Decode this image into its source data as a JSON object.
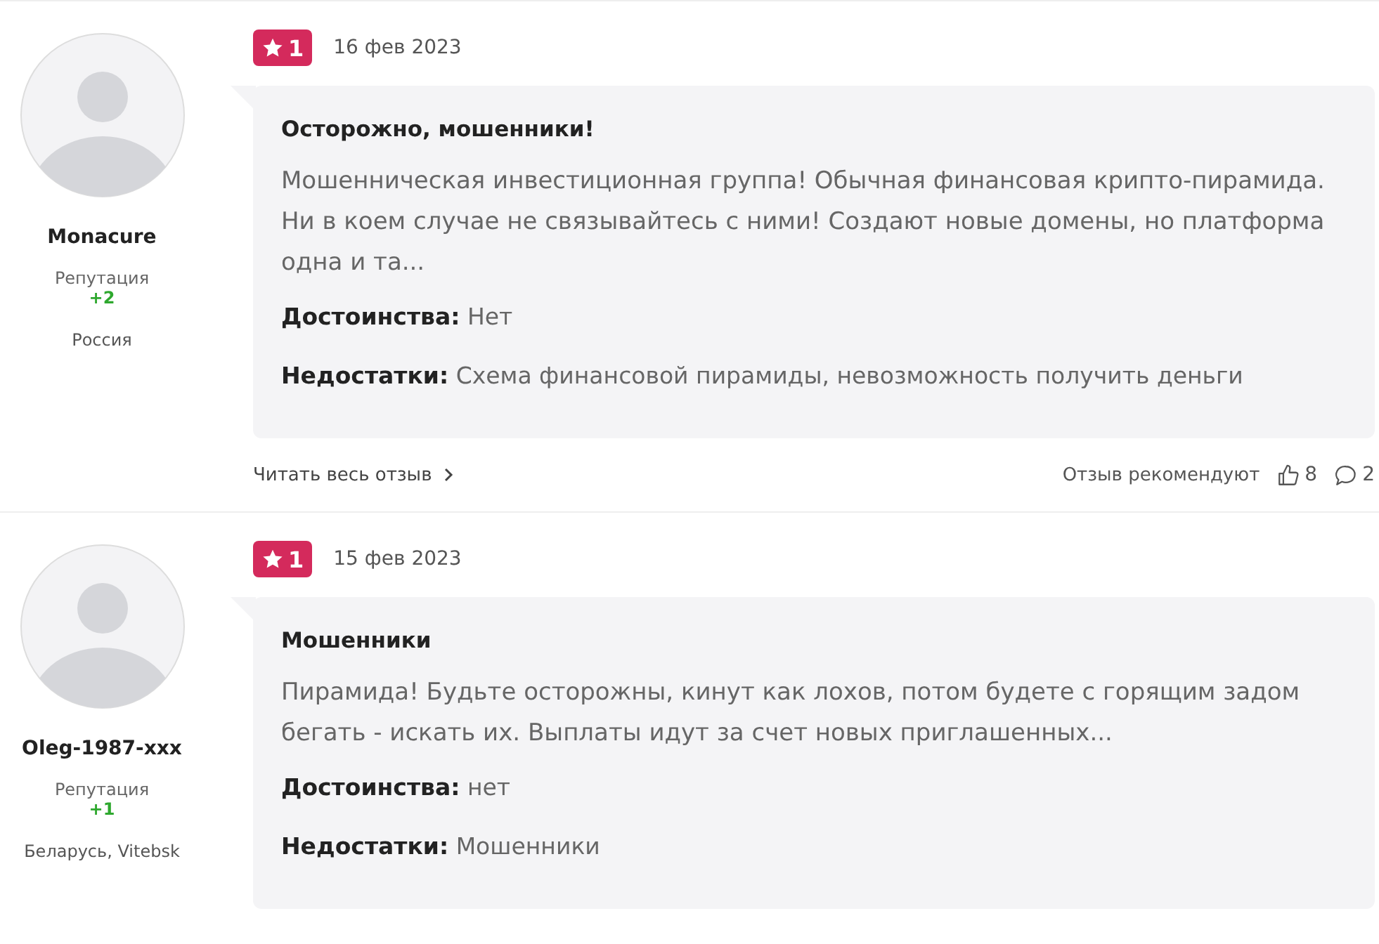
{
  "reviews": [
    {
      "user": {
        "name": "Monacure",
        "reputation_label": "Репутация",
        "reputation": "+2",
        "location": "Россия"
      },
      "rating": "1",
      "date": "16 фев 2023",
      "title": "Осторожно, мошенники!",
      "text": "Мошенническая инвестиционная группа! Обычная финансовая крипто-пирамида. Ни в коем случае не связывайтесь с ними! Создают новые домены, но платформа одна и та...",
      "pros_label": "Достоинства:",
      "pros": "Нет",
      "cons_label": "Недостатки:",
      "cons": "Схема финансовой пирамиды, невозможность получить деньги",
      "footer": {
        "read_more": "Читать весь отзыв",
        "recommend_label": "Отзыв рекомендуют",
        "likes": "8",
        "comments": "2"
      }
    },
    {
      "user": {
        "name": "Oleg-1987-xxx",
        "reputation_label": "Репутация",
        "reputation": "+1",
        "location": "Беларусь, Vitebsk"
      },
      "rating": "1",
      "date": "15 фев 2023",
      "title": "Мошенники",
      "text": "Пирамида! Будьте осторожны, кинут как лохов, потом будете с горящим задом бегать - искать их. Выплаты идут за счет новых приглашенных...",
      "pros_label": "Достоинства:",
      "pros": "нет",
      "cons_label": "Недостатки:",
      "cons": "Мошенники"
    }
  ]
}
